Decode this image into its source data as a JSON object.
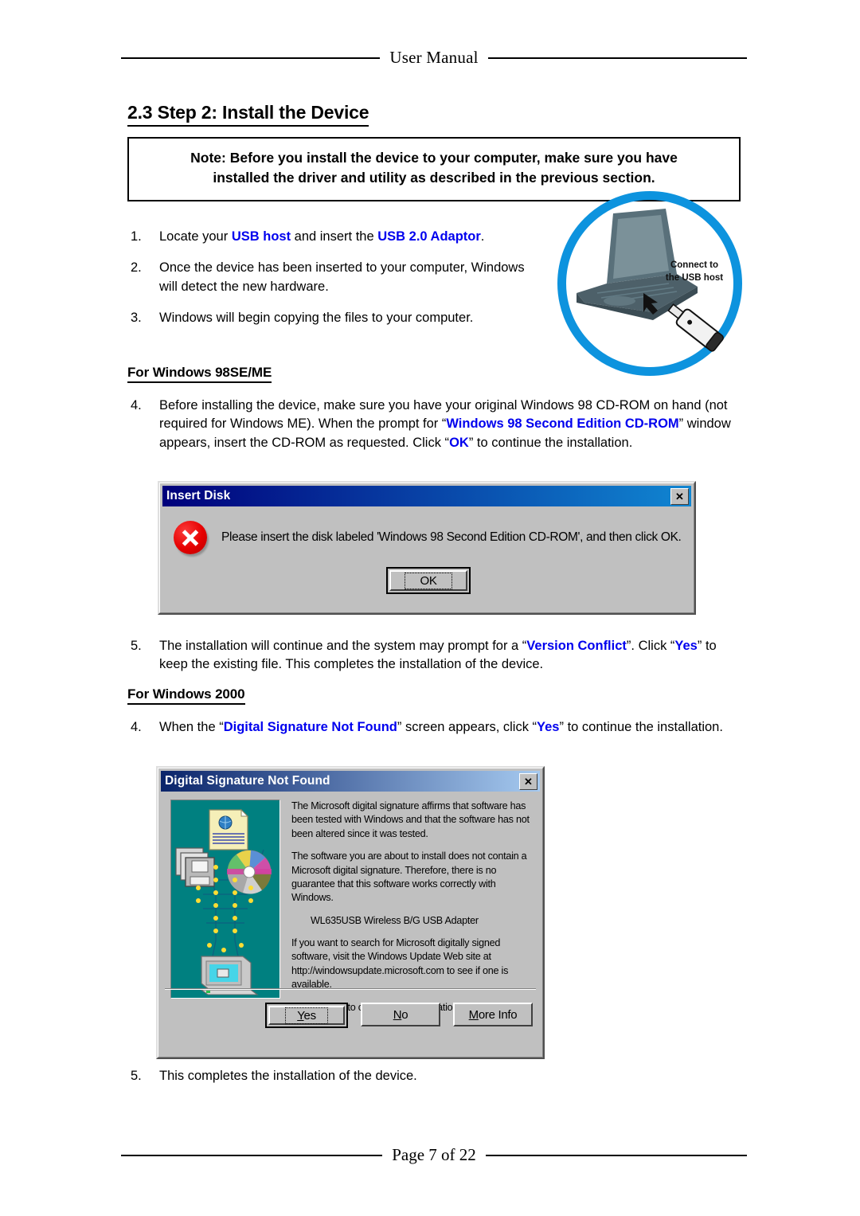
{
  "header": {
    "running_head": "User Manual"
  },
  "section": {
    "title": "2.3 Step 2: Install the Device"
  },
  "note_box": {
    "line1": "Note: Before you install the device to your computer, make sure you have",
    "line2": "installed the driver and utility as described in the previous section."
  },
  "steps_main": [
    {
      "num": "1.",
      "parts": [
        {
          "t": "Locate your ",
          "s": "plain"
        },
        {
          "t": "USB host",
          "s": "blue"
        },
        {
          "t": " and insert the ",
          "s": "plain"
        },
        {
          "t": "USB 2.0 Adaptor",
          "s": "blue"
        },
        {
          "t": ".",
          "s": "plain"
        }
      ]
    },
    {
      "num": "2.",
      "parts": [
        {
          "t": "Once the device has been inserted to your computer, Windows will detect the new hardware.",
          "s": "plain"
        }
      ]
    },
    {
      "num": "3.",
      "parts": [
        {
          "t": "Windows will begin copying the files to your computer.",
          "s": "plain"
        }
      ]
    }
  ],
  "illustration": {
    "caption_line1": "Connect to",
    "caption_line2": "the USB host",
    "ring_color": "#0d93de",
    "device_color": "#4d6069"
  },
  "subhead_98": "For Windows 98SE/ME",
  "steps_98": [
    {
      "num": "4.",
      "parts": [
        {
          "t": "Before installing the device, make sure you have your original Windows 98 CD-ROM on hand (not required for Windows ME). When the prompt for “",
          "s": "plain"
        },
        {
          "t": "Windows 98 Second Edition CD-ROM",
          "s": "blue"
        },
        {
          "t": "” window appears, insert the CD-ROM as requested. Click “",
          "s": "plain"
        },
        {
          "t": "OK",
          "s": "blue"
        },
        {
          "t": "” to continue the installation.",
          "s": "plain"
        }
      ]
    }
  ],
  "steps_98_after": [
    {
      "num": "5.",
      "parts": [
        {
          "t": "The installation will continue and the system may prompt for a “",
          "s": "plain"
        },
        {
          "t": "Version Conflict",
          "s": "blue"
        },
        {
          "t": "”. Click “",
          "s": "plain"
        },
        {
          "t": "Yes",
          "s": "blue"
        },
        {
          "t": "” to keep the existing file. This completes the installation of the device.",
          "s": "plain"
        }
      ]
    }
  ],
  "subhead_2000": "For Windows 2000",
  "steps_2000": [
    {
      "num": "4.",
      "parts": [
        {
          "t": "When the “",
          "s": "plain"
        },
        {
          "t": "Digital Signature Not Found",
          "s": "blue"
        },
        {
          "t": "” screen appears, click “",
          "s": "plain"
        },
        {
          "t": "Yes",
          "s": "blue"
        },
        {
          "t": "” to continue the installation.",
          "s": "plain"
        }
      ]
    }
  ],
  "steps_2000_after": [
    {
      "num": "5.",
      "parts": [
        {
          "t": "This completes the installation of the device.",
          "s": "plain"
        }
      ]
    }
  ],
  "insert_disk_dialog": {
    "title": "Insert Disk",
    "close_label": "✕",
    "message": "Please insert the disk labeled 'Windows 98 Second Edition CD-ROM', and then click OK.",
    "ok_label": "OK",
    "titlebar_color_start": "#00007b",
    "titlebar_color_end": "#1086d2"
  },
  "digital_signature_dialog": {
    "title": "Digital Signature Not Found",
    "close_label": "✕",
    "paragraph1": "The Microsoft digital signature affirms that software has been tested with Windows and that the software has not been altered since it was tested.",
    "paragraph2": "The software you are about to install does not contain a Microsoft digital signature. Therefore,  there is no guarantee that this software works correctly with Windows.",
    "device_name": "WL635USB Wireless B/G USB Adapter",
    "paragraph3": "If you want to search for Microsoft digitally signed software, visit the Windows Update Web site at http://windowsupdate.microsoft.com to see if one is available.",
    "question": "Do you want to continue the installation?",
    "buttons": [
      {
        "label_pre": "",
        "label_mnemonic": "Y",
        "label_post": "es",
        "default": true
      },
      {
        "label_pre": "",
        "label_mnemonic": "N",
        "label_post": "o",
        "default": false
      },
      {
        "label_pre": "",
        "label_mnemonic": "M",
        "label_post": "ore Info",
        "default": false
      }
    ],
    "titlebar_color_start": "#0a246a",
    "titlebar_color_end": "#a6caf0",
    "graphic_background": "#008080"
  },
  "footer": {
    "page_label": "Page 7 of 22"
  }
}
